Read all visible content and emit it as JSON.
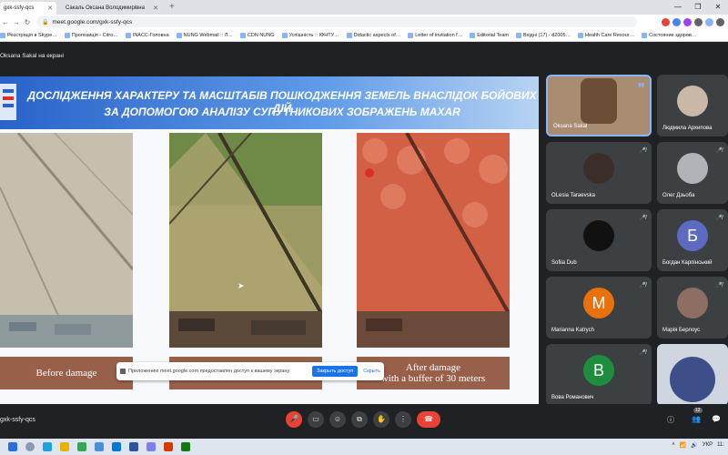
{
  "browser": {
    "tabs": [
      {
        "label": "gxk-ssfy-qcs",
        "active": true
      },
      {
        "label": "Сакаль Оксана Володимирівна",
        "active": false
      }
    ],
    "url": "meet.google.com/gxk-ssfy-qcs",
    "bookmarks": [
      "Реєстрація в Skype…",
      "Пропозиція - Citro…",
      "INACC-Головна",
      "NUNG Webmail :: Л…",
      "CDN NUNG",
      "Успішність :: ІФНТУ…",
      "Didactic aspects of…",
      "Letter of invitation f…",
      "Editorial Team",
      "Вхідні (17) - d2005…",
      "Health Care Resour…",
      "Состояние здоров…"
    ]
  },
  "meet": {
    "presenter_label": "Oksana Sakal на екрані",
    "slide": {
      "title_line1": "ДОСЛІДЖЕННЯ ХАРАКТЕРУ ТА МАСШТАБІВ ПОШКОДЖЕННЯ ЗЕМЕЛЬ ВНАСЛІДОК БОЙОВИХ ДІЙ",
      "title_line2": "ЗА ДОПОМОГОЮ АНАЛІЗУ СУПУТНИКОВИХ ЗОБРАЖЕНЬ MAXAR",
      "caption_before": "Before damage",
      "caption_after_line1": "After damage",
      "caption_after_line2": "with a buffer of 30 meters"
    },
    "share_banner": {
      "text": "Приложению meet.google.com предоставлен доступ к вашему экрану.",
      "stop_label": "Закрыть доступ",
      "hide_label": "Скрыть"
    },
    "participants": [
      {
        "name": "Oksana Sakal",
        "initial": "",
        "color": "#8a6a4a",
        "muted": false
      },
      {
        "name": "Людмила Архипова",
        "initial": "",
        "color": "#9aa0a6",
        "muted": false
      },
      {
        "name": "OLesia Taraevska",
        "initial": "",
        "color": "#5a4b45",
        "muted": true
      },
      {
        "name": "Олег Дзьоба",
        "initial": "",
        "color": "#b0b4b8",
        "muted": true
      },
      {
        "name": "Sofiia Dub",
        "initial": "",
        "color": "#2a2a2a",
        "muted": true
      },
      {
        "name": "Богдан Карпінський",
        "initial": "Б",
        "color": "#5c6bc0",
        "muted": true
      },
      {
        "name": "Marianna Katrych",
        "initial": "M",
        "color": "#e8710a",
        "muted": true
      },
      {
        "name": "Марія Берлоус",
        "initial": "",
        "color": "#8d6e63",
        "muted": true
      },
      {
        "name": "Вова Романович",
        "initial": "В",
        "color": "#1e8e3e",
        "muted": true
      },
      {
        "name": "",
        "initial": "",
        "color": "#6d7b99",
        "muted": false
      }
    ],
    "meeting_code": "gxk-ssfy-qcs",
    "participant_count": "12"
  },
  "taskbar": {
    "language": "УКР",
    "time": "11:"
  }
}
